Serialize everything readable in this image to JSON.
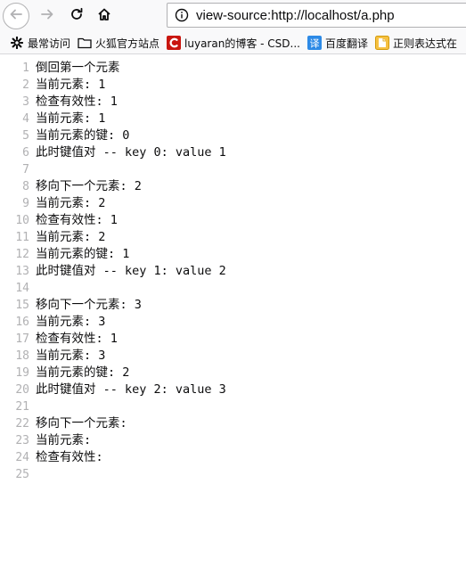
{
  "toolbar": {
    "back_icon": "arrow-left-icon",
    "forward_icon": "arrow-right-icon",
    "reload_icon": "reload-icon",
    "home_icon": "home-icon",
    "url": "view-source:http://localhost/a.php"
  },
  "bookmarks": [
    {
      "label": "最常访问",
      "icon": "gear-icon"
    },
    {
      "label": "火狐官方站点",
      "icon": "folder-icon"
    },
    {
      "label": "luyaran的博客 - CSD...",
      "icon": "csdn-icon"
    },
    {
      "label": "百度翻译",
      "icon": "translate-icon"
    },
    {
      "label": "正则表达式在",
      "icon": "bookmark-icon"
    }
  ],
  "source_lines": [
    {
      "n": "1",
      "text": "倒回第一个元素"
    },
    {
      "n": "2",
      "text": "当前元素: 1"
    },
    {
      "n": "3",
      "text": "检查有效性: 1"
    },
    {
      "n": "4",
      "text": "当前元素: 1"
    },
    {
      "n": "5",
      "text": "当前元素的键: 0"
    },
    {
      "n": "6",
      "text": "此时键值对 -- key 0: value 1"
    },
    {
      "n": "7",
      "text": ""
    },
    {
      "n": "8",
      "text": "移向下一个元素: 2"
    },
    {
      "n": "9",
      "text": "当前元素: 2"
    },
    {
      "n": "10",
      "text": "检查有效性: 1"
    },
    {
      "n": "11",
      "text": "当前元素: 2"
    },
    {
      "n": "12",
      "text": "当前元素的键: 1"
    },
    {
      "n": "13",
      "text": "此时键值对 -- key 1: value 2"
    },
    {
      "n": "14",
      "text": ""
    },
    {
      "n": "15",
      "text": "移向下一个元素: 3"
    },
    {
      "n": "16",
      "text": "当前元素: 3"
    },
    {
      "n": "17",
      "text": "检查有效性: 1"
    },
    {
      "n": "18",
      "text": "当前元素: 3"
    },
    {
      "n": "19",
      "text": "当前元素的键: 2"
    },
    {
      "n": "20",
      "text": "此时键值对 -- key 2: value 3"
    },
    {
      "n": "21",
      "text": ""
    },
    {
      "n": "22",
      "text": "移向下一个元素:"
    },
    {
      "n": "23",
      "text": "当前元素:"
    },
    {
      "n": "24",
      "text": "检查有效性:"
    },
    {
      "n": "25",
      "text": ""
    }
  ]
}
